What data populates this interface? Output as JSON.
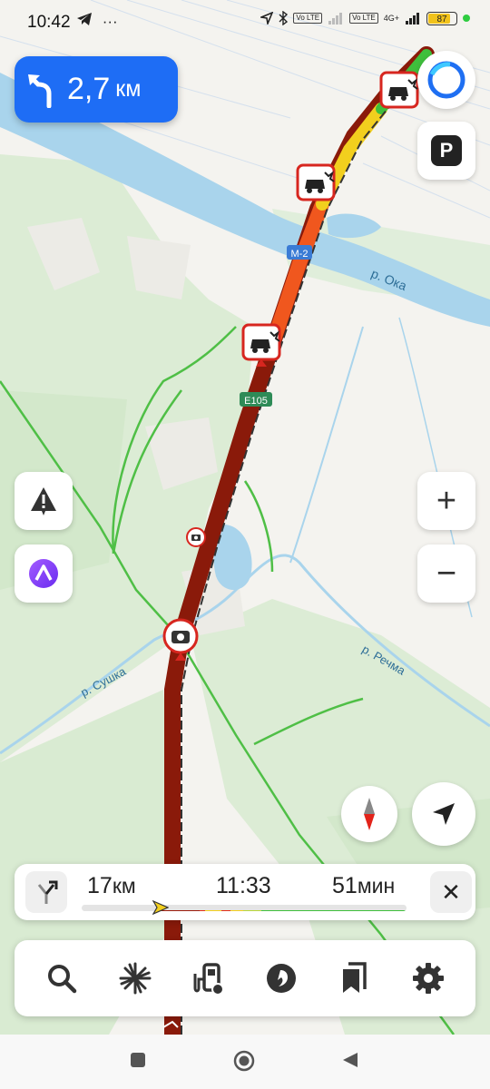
{
  "status_bar": {
    "time": "10:42",
    "left_icons": [
      "telegram-icon",
      "more-icon"
    ],
    "right_icons": [
      "location-icon",
      "bluetooth-icon",
      "volte-icon",
      "signal-icon",
      "4g-icon",
      "signal-icon"
    ],
    "volte_label": "Vo LTE",
    "network_label": "4G+",
    "battery_percent": "87"
  },
  "maneuver": {
    "icon": "turn-left-icon",
    "distance": "2,7",
    "unit": "км"
  },
  "map": {
    "labels": {
      "river_oka": "р. Ока",
      "river_sushka": "р. Сушка",
      "river_rechma": "р. Речма",
      "road_m2": "М-2",
      "road_e105": "E105"
    },
    "colors": {
      "water": "#a9d4ec",
      "forest": "#d9ebd3",
      "jam_heavy": "#8a1a0a",
      "jam_medium": "#f0571e",
      "jam_light": "#f2cf1e",
      "free": "#3fbf3c",
      "incident_border": "#d7261f"
    },
    "incidents": [
      "accident-icon",
      "accident-icon",
      "accident-icon"
    ],
    "cameras": [
      "speed-camera-icon",
      "speed-camera-icon"
    ]
  },
  "buttons": {
    "alice": "alice-icon",
    "parking": "P",
    "report": "warning-icon",
    "assistant": "voice-assistant-icon",
    "zoom_in": "+",
    "zoom_out": "−",
    "compass": "compass-icon",
    "locate": "locate-arrow-icon"
  },
  "route": {
    "distance": "17",
    "distance_unit": "км",
    "arrival_time": "11:33",
    "duration": "51",
    "duration_unit": "мин",
    "progress_fraction": 0.24,
    "close_label": "✕"
  },
  "toolbar": [
    "search-icon",
    "discovery-icon",
    "gas-station-icon",
    "music-icon",
    "bookmarks-icon",
    "settings-icon"
  ],
  "system_nav": [
    "recents-button",
    "home-button",
    "back-button"
  ]
}
